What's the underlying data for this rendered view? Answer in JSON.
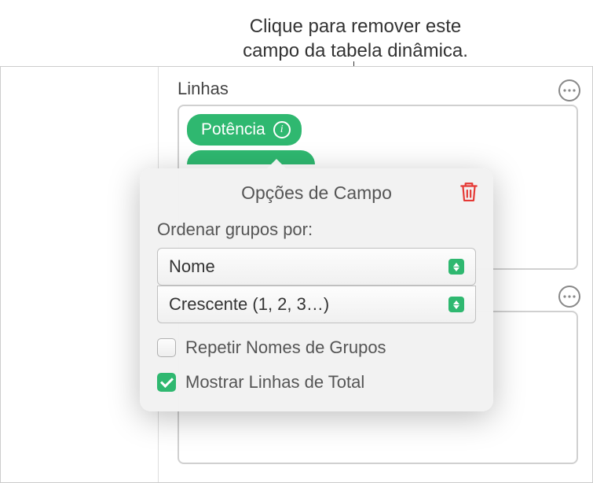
{
  "callout": {
    "line1": "Clique para remover este",
    "line2": "campo da tabela dinâmica."
  },
  "section": {
    "title": "Linhas"
  },
  "field": {
    "label": "Potência"
  },
  "popover": {
    "title": "Opções de Campo",
    "sort_label": "Ordenar grupos por:",
    "sort_by": "Nome",
    "sort_order": "Crescente (1, 2, 3…)",
    "repeat_names": "Repetir Nomes de Grupos",
    "show_totals": "Mostrar Linhas de Total"
  }
}
